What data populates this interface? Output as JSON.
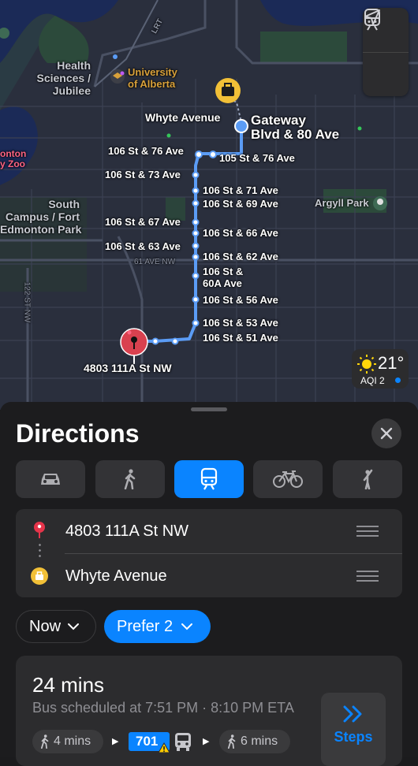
{
  "map": {
    "place_labels": {
      "health": [
        "Health",
        "Sciences /",
        "Jubilee"
      ],
      "university": [
        "University",
        "of Alberta"
      ],
      "whyte": "Whyte Avenue",
      "gateway": [
        "Gateway",
        "Blvd & 80 Ave"
      ],
      "zoo": [
        "onton",
        "y Zoo"
      ],
      "south_campus": [
        "South",
        "Campus / Fort",
        "Edmonton Park"
      ],
      "argyll": "Argyll Park",
      "lrt": "LRT",
      "ave61": "61 AVE NW",
      "st122": "122 ST NW",
      "origin": "4803 111A St NW"
    },
    "stops": {
      "s1": "106 St & 76 Ave",
      "s2": "105 St & 76 Ave",
      "s3": "106 St & 73 Ave",
      "s4": "106 St & 71 Ave",
      "s5": "106 St & 69 Ave",
      "s6": "106 St & 67 Ave",
      "s7": "106 St & 66 Ave",
      "s8": "106 St & 63 Ave",
      "s9": "106 St & 62 Ave",
      "s10a": "106 St &",
      "s10b": "60A Ave",
      "s11": "106 St & 56 Ave",
      "s12": "106 St & 53 Ave",
      "s13": "106 St & 51 Ave"
    },
    "weather": {
      "temp": "21°",
      "aqi": "AQI 2"
    },
    "controls": [
      "transit-view-icon",
      "location-arrow-icon"
    ],
    "route_color": "#5b9cf5"
  },
  "sheet": {
    "title": "Directions",
    "modes": [
      {
        "name": "drive",
        "icon": "car-icon",
        "active": false
      },
      {
        "name": "walk",
        "icon": "walking-icon",
        "active": false
      },
      {
        "name": "transit",
        "icon": "tram-icon",
        "active": true
      },
      {
        "name": "cycle",
        "icon": "bicycle-icon",
        "active": false
      },
      {
        "name": "ride",
        "icon": "hail-icon",
        "active": false
      }
    ],
    "from": "4803 111A St NW",
    "to": "Whyte Avenue",
    "when": "Now",
    "prefer": "Prefer 2",
    "result": {
      "duration": "24 mins",
      "schedule": "Bus scheduled at 7:51 PM · 8:10 PM ETA",
      "walk1": "4 mins",
      "bus": "701",
      "walk2": "6 mins",
      "steps_label": "Steps"
    },
    "accent": "#0a84ff"
  }
}
